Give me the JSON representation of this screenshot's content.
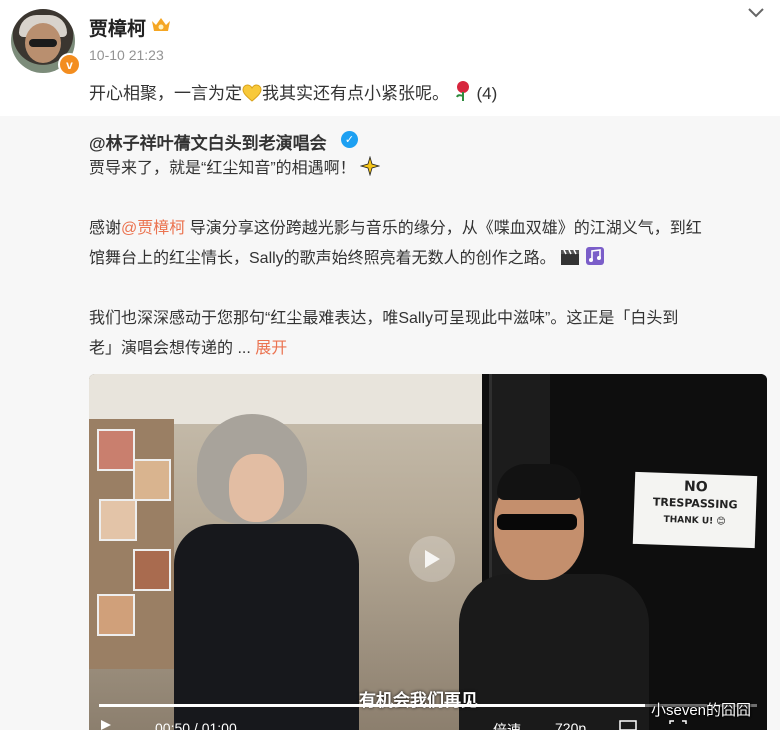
{
  "post": {
    "username": "贾樟柯",
    "time": "10-10 21:23",
    "text_before": "开心相聚，一言为定",
    "text_after": "我其实还有点小紧张呢。",
    "count": "(4)",
    "icons": {
      "level": "crown-level-icon",
      "heart": "yellow-heart-emoji",
      "rose": "rose-emoji",
      "verified": "orange-v-badge"
    }
  },
  "repost": {
    "author": "@林子祥叶蒨文白头到老演唱会",
    "line1": "贾导来了，就是“红尘知音”的相遇啊！",
    "para2_prefix": "感谢",
    "para2_mention": "@贾樟柯",
    "para2_rest": " 导演分享这份跨越光影与音乐的缘分，从《喋血双雄》的江湖义气，到红",
    "para2_line2": "馆舞台上的红尘情长，Sally的歌声始终照亮着无数人的创作之路。",
    "para3_line1": "我们也深深感动于您那句“红尘最难表达，唯Sally可呈现此中滋味”。这正是「白头到",
    "para3_line2": "老」演唱会想传递的 ...",
    "expand_label": "展开"
  },
  "video": {
    "sign": {
      "line1": "NO",
      "line2": "TRESPASSING",
      "line3": "THANK U! 😊"
    },
    "subtitle": "有机会我们再见",
    "current_time": "00:50",
    "duration": "01:00",
    "time_display": "00:50 / 01:00",
    "speed_label": "倍速",
    "quality_label": "720p",
    "progress": 0.83
  },
  "watermark": "小seven的囧囧"
}
